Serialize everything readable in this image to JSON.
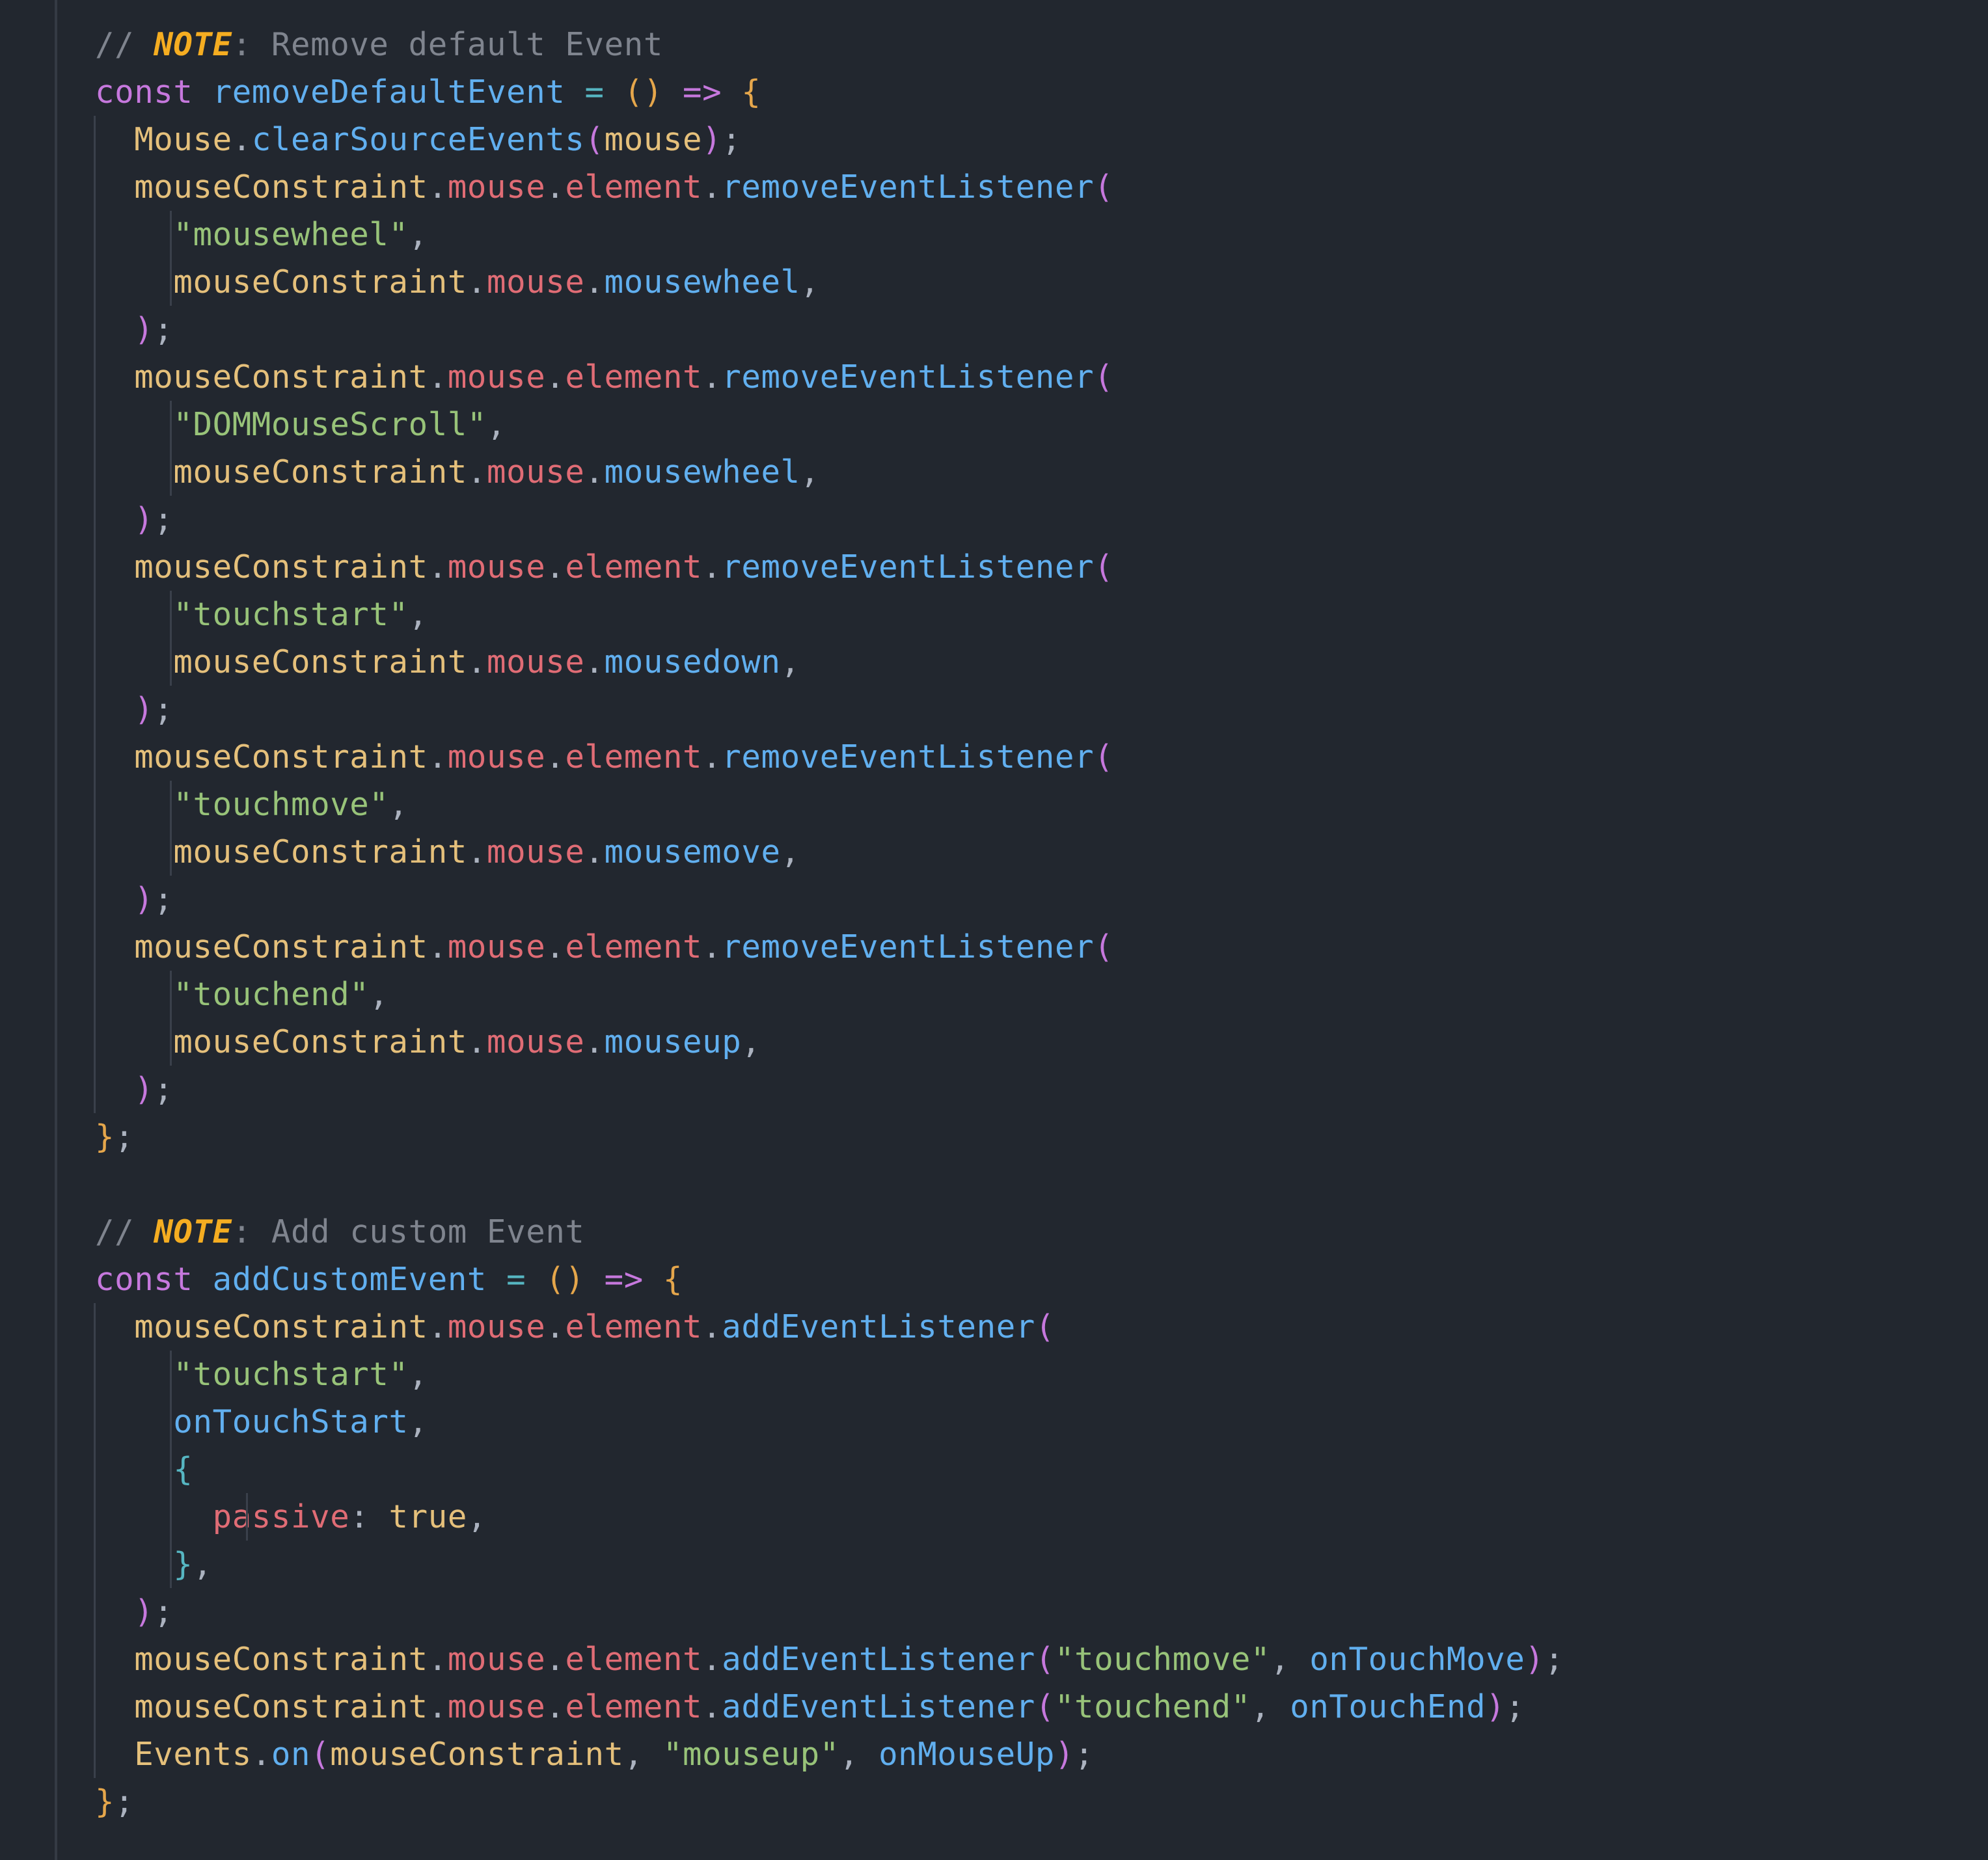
{
  "editor": {
    "theme": {
      "background": "#22272f",
      "comment": "#7f848e",
      "note_tag": "#f5ad21",
      "keyword": "#c678dd",
      "function": "#61afef",
      "operator": "#56b6c2",
      "variable": "#e5c07b",
      "property": "#e06c75",
      "string": "#98c379",
      "punctuation": "#abb2bf"
    },
    "lines": [
      [
        {
          "t": "// ",
          "c": "cm"
        },
        {
          "t": "NOTE",
          "c": "note"
        },
        {
          "t": ": Remove default Event",
          "c": "cm"
        }
      ],
      [
        {
          "t": "const ",
          "c": "kw"
        },
        {
          "t": "removeDefaultEvent",
          "c": "fn"
        },
        {
          "t": " = ",
          "c": "op"
        },
        {
          "t": "()",
          "c": "par1"
        },
        {
          "t": " => ",
          "c": "kw"
        },
        {
          "t": "{",
          "c": "par1"
        }
      ],
      [
        {
          "t": "  "
        },
        {
          "t": "Mouse",
          "c": "var"
        },
        {
          "t": ".",
          "c": "pun"
        },
        {
          "t": "clearSourceEvents",
          "c": "fn"
        },
        {
          "t": "(",
          "c": "par2"
        },
        {
          "t": "mouse",
          "c": "var"
        },
        {
          "t": ")",
          "c": "par2"
        },
        {
          "t": ";",
          "c": "pun"
        }
      ],
      [
        {
          "t": "  "
        },
        {
          "t": "mouseConstraint",
          "c": "var"
        },
        {
          "t": ".",
          "c": "pun"
        },
        {
          "t": "mouse",
          "c": "prop"
        },
        {
          "t": ".",
          "c": "pun"
        },
        {
          "t": "element",
          "c": "prop"
        },
        {
          "t": ".",
          "c": "pun"
        },
        {
          "t": "removeEventListener",
          "c": "fn"
        },
        {
          "t": "(",
          "c": "par2"
        }
      ],
      [
        {
          "t": "    "
        },
        {
          "t": "\"mousewheel\"",
          "c": "str"
        },
        {
          "t": ",",
          "c": "pun"
        }
      ],
      [
        {
          "t": "    "
        },
        {
          "t": "mouseConstraint",
          "c": "var"
        },
        {
          "t": ".",
          "c": "pun"
        },
        {
          "t": "mouse",
          "c": "prop"
        },
        {
          "t": ".",
          "c": "pun"
        },
        {
          "t": "mousewheel",
          "c": "fn"
        },
        {
          "t": ",",
          "c": "pun"
        }
      ],
      [
        {
          "t": "  "
        },
        {
          "t": ")",
          "c": "par2"
        },
        {
          "t": ";",
          "c": "pun"
        }
      ],
      [
        {
          "t": "  "
        },
        {
          "t": "mouseConstraint",
          "c": "var"
        },
        {
          "t": ".",
          "c": "pun"
        },
        {
          "t": "mouse",
          "c": "prop"
        },
        {
          "t": ".",
          "c": "pun"
        },
        {
          "t": "element",
          "c": "prop"
        },
        {
          "t": ".",
          "c": "pun"
        },
        {
          "t": "removeEventListener",
          "c": "fn"
        },
        {
          "t": "(",
          "c": "par2"
        }
      ],
      [
        {
          "t": "    "
        },
        {
          "t": "\"DOMMouseScroll\"",
          "c": "str"
        },
        {
          "t": ",",
          "c": "pun"
        }
      ],
      [
        {
          "t": "    "
        },
        {
          "t": "mouseConstraint",
          "c": "var"
        },
        {
          "t": ".",
          "c": "pun"
        },
        {
          "t": "mouse",
          "c": "prop"
        },
        {
          "t": ".",
          "c": "pun"
        },
        {
          "t": "mousewheel",
          "c": "fn"
        },
        {
          "t": ",",
          "c": "pun"
        }
      ],
      [
        {
          "t": "  "
        },
        {
          "t": ")",
          "c": "par2"
        },
        {
          "t": ";",
          "c": "pun"
        }
      ],
      [
        {
          "t": "  "
        },
        {
          "t": "mouseConstraint",
          "c": "var"
        },
        {
          "t": ".",
          "c": "pun"
        },
        {
          "t": "mouse",
          "c": "prop"
        },
        {
          "t": ".",
          "c": "pun"
        },
        {
          "t": "element",
          "c": "prop"
        },
        {
          "t": ".",
          "c": "pun"
        },
        {
          "t": "removeEventListener",
          "c": "fn"
        },
        {
          "t": "(",
          "c": "par2"
        }
      ],
      [
        {
          "t": "    "
        },
        {
          "t": "\"touchstart\"",
          "c": "str"
        },
        {
          "t": ",",
          "c": "pun"
        }
      ],
      [
        {
          "t": "    "
        },
        {
          "t": "mouseConstraint",
          "c": "var"
        },
        {
          "t": ".",
          "c": "pun"
        },
        {
          "t": "mouse",
          "c": "prop"
        },
        {
          "t": ".",
          "c": "pun"
        },
        {
          "t": "mousedown",
          "c": "fn"
        },
        {
          "t": ",",
          "c": "pun"
        }
      ],
      [
        {
          "t": "  "
        },
        {
          "t": ")",
          "c": "par2"
        },
        {
          "t": ";",
          "c": "pun"
        }
      ],
      [
        {
          "t": "  "
        },
        {
          "t": "mouseConstraint",
          "c": "var"
        },
        {
          "t": ".",
          "c": "pun"
        },
        {
          "t": "mouse",
          "c": "prop"
        },
        {
          "t": ".",
          "c": "pun"
        },
        {
          "t": "element",
          "c": "prop"
        },
        {
          "t": ".",
          "c": "pun"
        },
        {
          "t": "removeEventListener",
          "c": "fn"
        },
        {
          "t": "(",
          "c": "par2"
        }
      ],
      [
        {
          "t": "    "
        },
        {
          "t": "\"touchmove\"",
          "c": "str"
        },
        {
          "t": ",",
          "c": "pun"
        }
      ],
      [
        {
          "t": "    "
        },
        {
          "t": "mouseConstraint",
          "c": "var"
        },
        {
          "t": ".",
          "c": "pun"
        },
        {
          "t": "mouse",
          "c": "prop"
        },
        {
          "t": ".",
          "c": "pun"
        },
        {
          "t": "mousemove",
          "c": "fn"
        },
        {
          "t": ",",
          "c": "pun"
        }
      ],
      [
        {
          "t": "  "
        },
        {
          "t": ")",
          "c": "par2"
        },
        {
          "t": ";",
          "c": "pun"
        }
      ],
      [
        {
          "t": "  "
        },
        {
          "t": "mouseConstraint",
          "c": "var"
        },
        {
          "t": ".",
          "c": "pun"
        },
        {
          "t": "mouse",
          "c": "prop"
        },
        {
          "t": ".",
          "c": "pun"
        },
        {
          "t": "element",
          "c": "prop"
        },
        {
          "t": ".",
          "c": "pun"
        },
        {
          "t": "removeEventListener",
          "c": "fn"
        },
        {
          "t": "(",
          "c": "par2"
        }
      ],
      [
        {
          "t": "    "
        },
        {
          "t": "\"touchend\"",
          "c": "str"
        },
        {
          "t": ",",
          "c": "pun"
        }
      ],
      [
        {
          "t": "    "
        },
        {
          "t": "mouseConstraint",
          "c": "var"
        },
        {
          "t": ".",
          "c": "pun"
        },
        {
          "t": "mouse",
          "c": "prop"
        },
        {
          "t": ".",
          "c": "pun"
        },
        {
          "t": "mouseup",
          "c": "fn"
        },
        {
          "t": ",",
          "c": "pun"
        }
      ],
      [
        {
          "t": "  "
        },
        {
          "t": ")",
          "c": "par2"
        },
        {
          "t": ";",
          "c": "pun"
        }
      ],
      [
        {
          "t": "}",
          "c": "par1"
        },
        {
          "t": ";",
          "c": "pun"
        }
      ],
      [],
      [
        {
          "t": "// ",
          "c": "cm"
        },
        {
          "t": "NOTE",
          "c": "note"
        },
        {
          "t": ": Add custom Event",
          "c": "cm"
        }
      ],
      [
        {
          "t": "const ",
          "c": "kw"
        },
        {
          "t": "addCustomEvent",
          "c": "fn"
        },
        {
          "t": " = ",
          "c": "op"
        },
        {
          "t": "()",
          "c": "par1"
        },
        {
          "t": " => ",
          "c": "kw"
        },
        {
          "t": "{",
          "c": "par1"
        }
      ],
      [
        {
          "t": "  "
        },
        {
          "t": "mouseConstraint",
          "c": "var"
        },
        {
          "t": ".",
          "c": "pun"
        },
        {
          "t": "mouse",
          "c": "prop"
        },
        {
          "t": ".",
          "c": "pun"
        },
        {
          "t": "element",
          "c": "prop"
        },
        {
          "t": ".",
          "c": "pun"
        },
        {
          "t": "addEventListener",
          "c": "fn"
        },
        {
          "t": "(",
          "c": "par2"
        }
      ],
      [
        {
          "t": "    "
        },
        {
          "t": "\"touchstart\"",
          "c": "str"
        },
        {
          "t": ",",
          "c": "pun"
        }
      ],
      [
        {
          "t": "    "
        },
        {
          "t": "onTouchStart",
          "c": "fn"
        },
        {
          "t": ",",
          "c": "pun"
        }
      ],
      [
        {
          "t": "    "
        },
        {
          "t": "{",
          "c": "par3"
        }
      ],
      [
        {
          "t": "      "
        },
        {
          "t": "passive",
          "c": "prop"
        },
        {
          "t": ": ",
          "c": "pun"
        },
        {
          "t": "true",
          "c": "var"
        },
        {
          "t": ",",
          "c": "pun"
        }
      ],
      [
        {
          "t": "    "
        },
        {
          "t": "}",
          "c": "par3"
        },
        {
          "t": ",",
          "c": "pun"
        }
      ],
      [
        {
          "t": "  "
        },
        {
          "t": ")",
          "c": "par2"
        },
        {
          "t": ";",
          "c": "pun"
        }
      ],
      [
        {
          "t": "  "
        },
        {
          "t": "mouseConstraint",
          "c": "var"
        },
        {
          "t": ".",
          "c": "pun"
        },
        {
          "t": "mouse",
          "c": "prop"
        },
        {
          "t": ".",
          "c": "pun"
        },
        {
          "t": "element",
          "c": "prop"
        },
        {
          "t": ".",
          "c": "pun"
        },
        {
          "t": "addEventListener",
          "c": "fn"
        },
        {
          "t": "(",
          "c": "par2"
        },
        {
          "t": "\"touchmove\"",
          "c": "str"
        },
        {
          "t": ", ",
          "c": "pun"
        },
        {
          "t": "onTouchMove",
          "c": "fn"
        },
        {
          "t": ")",
          "c": "par2"
        },
        {
          "t": ";",
          "c": "pun"
        }
      ],
      [
        {
          "t": "  "
        },
        {
          "t": "mouseConstraint",
          "c": "var"
        },
        {
          "t": ".",
          "c": "pun"
        },
        {
          "t": "mouse",
          "c": "prop"
        },
        {
          "t": ".",
          "c": "pun"
        },
        {
          "t": "element",
          "c": "prop"
        },
        {
          "t": ".",
          "c": "pun"
        },
        {
          "t": "addEventListener",
          "c": "fn"
        },
        {
          "t": "(",
          "c": "par2"
        },
        {
          "t": "\"touchend\"",
          "c": "str"
        },
        {
          "t": ", ",
          "c": "pun"
        },
        {
          "t": "onTouchEnd",
          "c": "fn"
        },
        {
          "t": ")",
          "c": "par2"
        },
        {
          "t": ";",
          "c": "pun"
        }
      ],
      [
        {
          "t": "  "
        },
        {
          "t": "Events",
          "c": "var"
        },
        {
          "t": ".",
          "c": "pun"
        },
        {
          "t": "on",
          "c": "fn"
        },
        {
          "t": "(",
          "c": "par2"
        },
        {
          "t": "mouseConstraint",
          "c": "var"
        },
        {
          "t": ", ",
          "c": "pun"
        },
        {
          "t": "\"mouseup\"",
          "c": "str"
        },
        {
          "t": ", ",
          "c": "pun"
        },
        {
          "t": "onMouseUp",
          "c": "fn"
        },
        {
          "t": ")",
          "c": "par2"
        },
        {
          "t": ";",
          "c": "pun"
        }
      ],
      [
        {
          "t": "}",
          "c": "par1"
        },
        {
          "t": ";",
          "c": "pun"
        }
      ]
    ]
  }
}
